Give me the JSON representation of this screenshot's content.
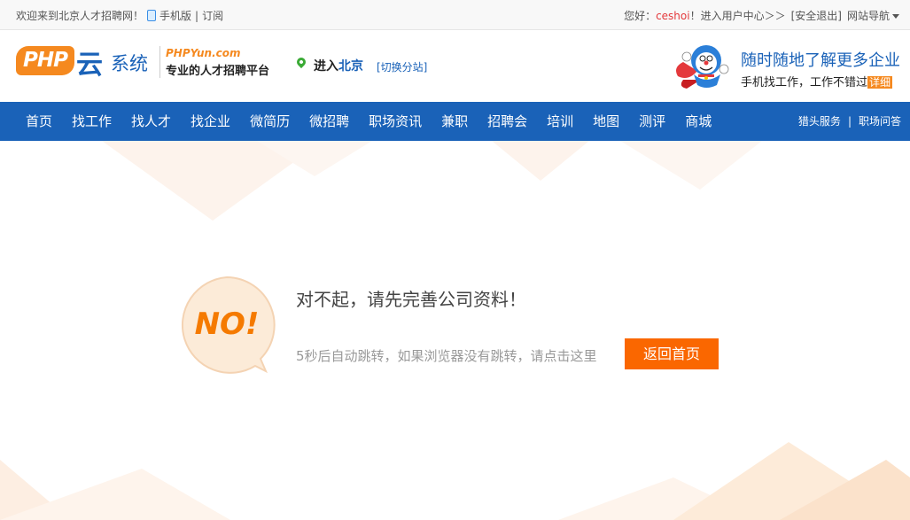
{
  "topbar": {
    "welcome": "欢迎来到北京人才招聘网！",
    "mobile_link": "手机版",
    "separator": "|",
    "subscribe_link": "订阅",
    "greeting_prefix": "您好：",
    "user_name": "ceshoi",
    "user_center": "！进入用户中心＞＞",
    "logout": "[安全退出]",
    "site_nav": "网站导航"
  },
  "header": {
    "logo_php": "PHP",
    "logo_yun": "云",
    "logo_system": "系统",
    "logo_site": "PHPYun.com",
    "logo_slogan": "专业的人才招聘平台",
    "city_enter": "进入",
    "city_name": "北京",
    "city_switch": "[切换分站]",
    "mobile_title": "随时随地了解更多企业",
    "mobile_subtitle": "手机找工作，工作不错过",
    "mobile_detail": "详细"
  },
  "nav": {
    "items": [
      "首页",
      "找工作",
      "找人才",
      "找企业",
      "微简历",
      "微招聘",
      "职场资讯",
      "兼职",
      "招聘会",
      "培训",
      "地图",
      "测评",
      "商城"
    ],
    "headhunter": "猎头服务",
    "separator": "|",
    "qa": "职场问答"
  },
  "message": {
    "badge": "NO!",
    "title": "对不起，请先完善公司资料！",
    "subtitle": "5秒后自动跳转，如果浏览器没有跳转，请点击这里",
    "home_button": "返回首页"
  },
  "colors": {
    "brand_blue": "#1a62b8",
    "brand_orange": "#f5891f",
    "button_orange": "#fa6700",
    "user_red": "#e4393c"
  }
}
